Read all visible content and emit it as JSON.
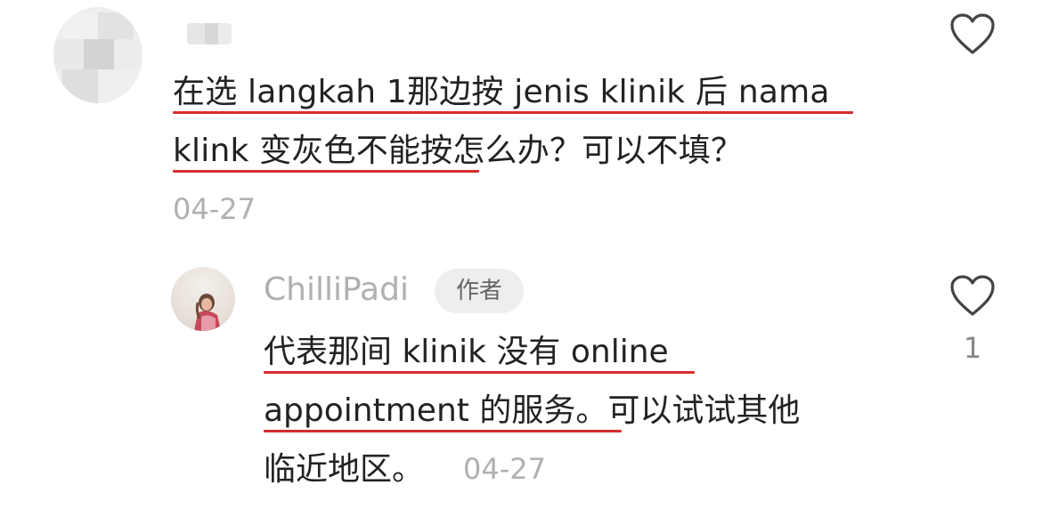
{
  "comment": {
    "author": "",
    "text_line1": "在选 langkah 1那边按 jenis klinik 后 nama",
    "text_line2": "klink 变灰色不能按怎么办？可以不填？",
    "date": "04-27"
  },
  "reply": {
    "author": "ChilliPadi",
    "badge": "作者",
    "text_line1": "代表那间 klinik 没有 online",
    "text_line2": "appointment 的服务。可以试试其他",
    "text_line3": "临近地区。",
    "date": "04-27",
    "likes": "1"
  },
  "colors": {
    "underline": "#d62d2d",
    "muted": "#b0b0b0",
    "text": "#222222"
  },
  "icons": {
    "like": "heart-outline-icon"
  }
}
